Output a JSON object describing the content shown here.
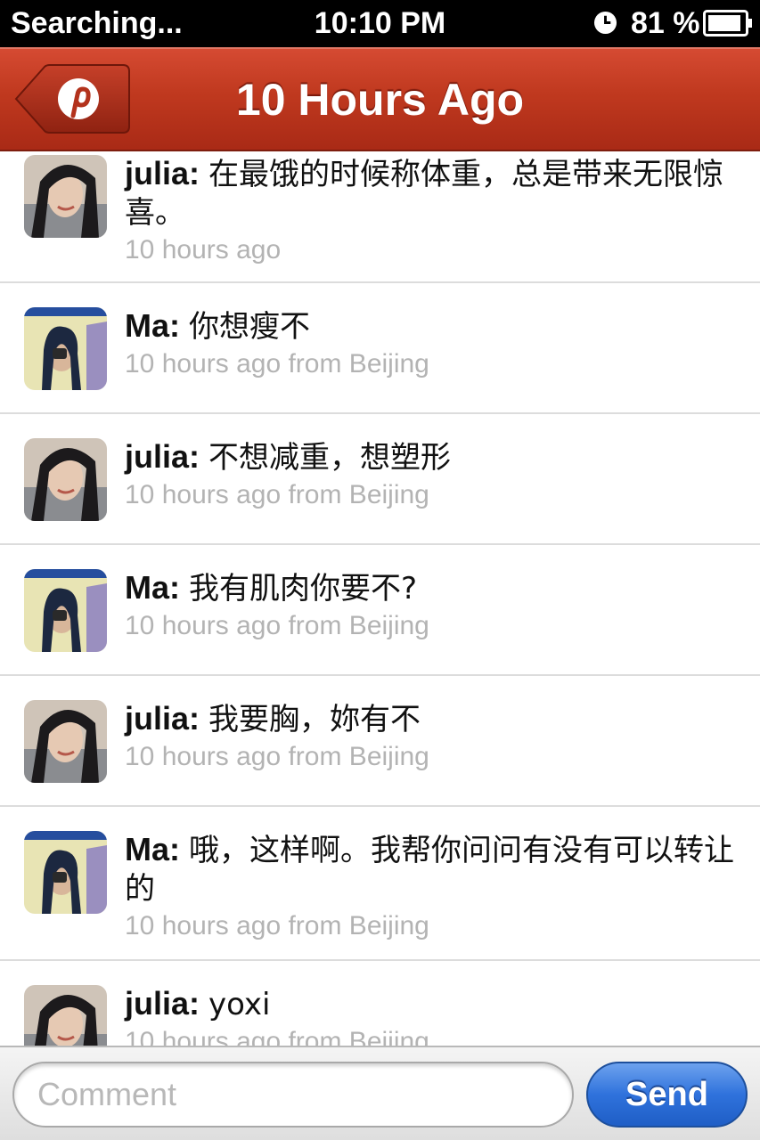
{
  "status_bar": {
    "carrier": "Searching...",
    "time": "10:10 PM",
    "battery": "81 %",
    "icons": [
      "clock-icon",
      "battery-icon"
    ]
  },
  "nav": {
    "title": "10 Hours Ago",
    "back_icon": "pinterest-logo-icon",
    "accent_color": "#c0391f"
  },
  "messages": [
    {
      "user": "julia",
      "avatar": "julia-avatar",
      "text": "在最饿的时候称体重，总是带来无限惊喜。",
      "meta": "10 hours ago"
    },
    {
      "user": "Ma",
      "avatar": "ma-avatar",
      "text": "你想瘦不",
      "meta": "10 hours ago from Beijing"
    },
    {
      "user": "julia",
      "avatar": "julia-avatar",
      "text": "不想减重，想塑形",
      "meta": "10 hours ago from Beijing"
    },
    {
      "user": "Ma",
      "avatar": "ma-avatar",
      "text": "我有肌肉你要不?",
      "meta": "10 hours ago from Beijing"
    },
    {
      "user": "julia",
      "avatar": "julia-avatar",
      "text": "我要胸，妳有不",
      "meta": "10 hours ago from Beijing"
    },
    {
      "user": "Ma",
      "avatar": "ma-avatar",
      "text": "哦，这样啊。我帮你问问有没有可以转让的",
      "meta": "10 hours ago from Beijing"
    },
    {
      "user": "julia",
      "avatar": "julia-avatar",
      "text": "yoxi",
      "meta": "10 hours ago from Beijing"
    }
  ],
  "comment": {
    "placeholder": "Comment",
    "value": "",
    "send_label": "Send",
    "send_color": "#2f72dc"
  }
}
